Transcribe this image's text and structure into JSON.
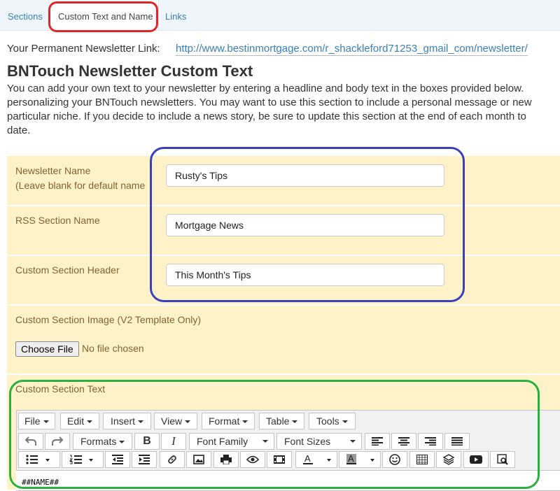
{
  "tabs": [
    "Sections",
    "Custom Text and Name",
    "Links"
  ],
  "permanent_link": {
    "label": "Your Permanent Newsletter Link:",
    "url": "http://www.bestinmortgage.com/r_shackleford71253_gmail_com/newsletter/"
  },
  "heading": "BNTouch Newsletter Custom Text",
  "intro_lines": [
    "You can add your own text to your newsletter by entering a headline and body text in the boxes provided below.",
    "personalizing your BNTouch newsletters. You may want to use this section to include a personal message or new",
    "particular niche. If you decide to include a news story, be sure to update this section at the end of each month to",
    "date."
  ],
  "fields": {
    "newsletter_name": {
      "label": "Newsletter Name",
      "sublabel": "(Leave blank for default name",
      "value": "Rusty's Tips"
    },
    "rss_section_name": {
      "label": "RSS Section Name",
      "value": "Mortgage News"
    },
    "custom_section_header": {
      "label": "Custom Section Header",
      "value": "This Month's Tips"
    },
    "custom_section_image": {
      "label": "Custom Section Image (V2 Template Only)",
      "button": "Choose File",
      "status": "No file chosen"
    },
    "custom_section_text": {
      "label": "Custom Section Text"
    }
  },
  "editor": {
    "menu": [
      "File",
      "Edit",
      "Insert",
      "View",
      "Format",
      "Table",
      "Tools"
    ],
    "formats_label": "Formats",
    "font_family_label": "Font Family",
    "font_sizes_label": "Font Sizes",
    "content": "##NAME##"
  },
  "colors": {
    "annotation_red": "#e0262a",
    "annotation_blue": "#3a3fbf",
    "annotation_green": "#28b040",
    "form_background": "#fef3c8",
    "label_color": "#856231",
    "link_color": "#3a80b7"
  }
}
